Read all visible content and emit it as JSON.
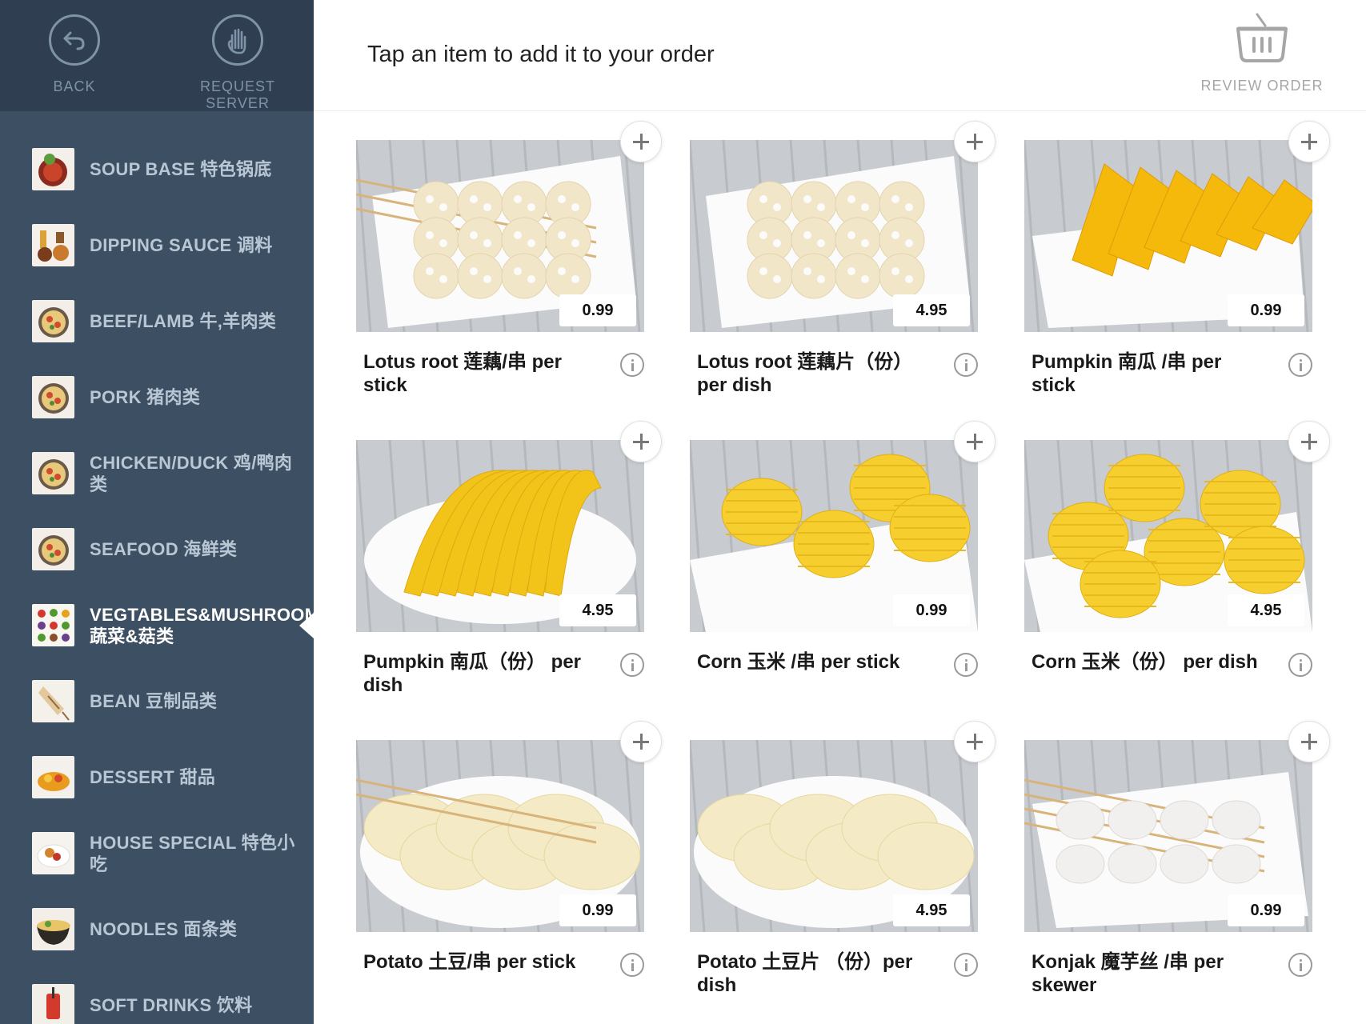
{
  "topbar": {
    "back_label": "BACK",
    "request_server_label": "REQUEST SERVER"
  },
  "header": {
    "instruction": "Tap an item to add it to your order",
    "review_order_label": "REVIEW ORDER"
  },
  "categories": [
    {
      "label": "SOUP BASE 特色锅底",
      "icon": "soup-base-icon"
    },
    {
      "label": "DIPPING SAUCE 调料",
      "icon": "dipping-sauce-icon"
    },
    {
      "label": "BEEF/LAMB 牛,羊肉类",
      "icon": "beef-lamb-icon"
    },
    {
      "label": "PORK  猪肉类",
      "icon": "pork-icon"
    },
    {
      "label": "CHICKEN/DUCK 鸡/鸭肉类",
      "icon": "chicken-duck-icon"
    },
    {
      "label": "SEAFOOD 海鲜类",
      "icon": "seafood-icon"
    },
    {
      "label": "VEGTABLES&MUSHROOM 蔬菜&菇类",
      "icon": "vegetables-icon",
      "active": true
    },
    {
      "label": "BEAN  豆制品类",
      "icon": "bean-icon"
    },
    {
      "label": "DESSERT 甜品",
      "icon": "dessert-icon"
    },
    {
      "label": "HOUSE SPECIAL 特色小吃",
      "icon": "house-special-icon"
    },
    {
      "label": "NOODLES 面条类",
      "icon": "noodles-icon"
    },
    {
      "label": "SOFT DRINKS  饮料",
      "icon": "soft-drinks-icon"
    }
  ],
  "items": [
    {
      "title": "Lotus root 莲藕/串 per stick",
      "price": "0.99"
    },
    {
      "title": "Lotus root 莲藕片（份） per dish",
      "price": "4.95"
    },
    {
      "title": "Pumpkin  南瓜 /串 per stick",
      "price": "0.99"
    },
    {
      "title": "Pumpkin  南瓜（份） per dish",
      "price": "4.95"
    },
    {
      "title": "Corn 玉米 /串 per stick",
      "price": "0.99"
    },
    {
      "title": "Corn 玉米（份）  per dish",
      "price": "4.95"
    },
    {
      "title": "Potato 土豆/串 per stick",
      "price": "0.99"
    },
    {
      "title": "Potato 土豆片 （份）per dish",
      "price": "4.95"
    },
    {
      "title": "Konjak 魔芋丝 /串 per skewer",
      "price": "0.99"
    }
  ],
  "colors": {
    "sidebar_bg": "#3d4f63",
    "topbar_bg": "#2f3f51",
    "sidebar_text": "#b9c6d4",
    "active_text": "#ffffff"
  }
}
